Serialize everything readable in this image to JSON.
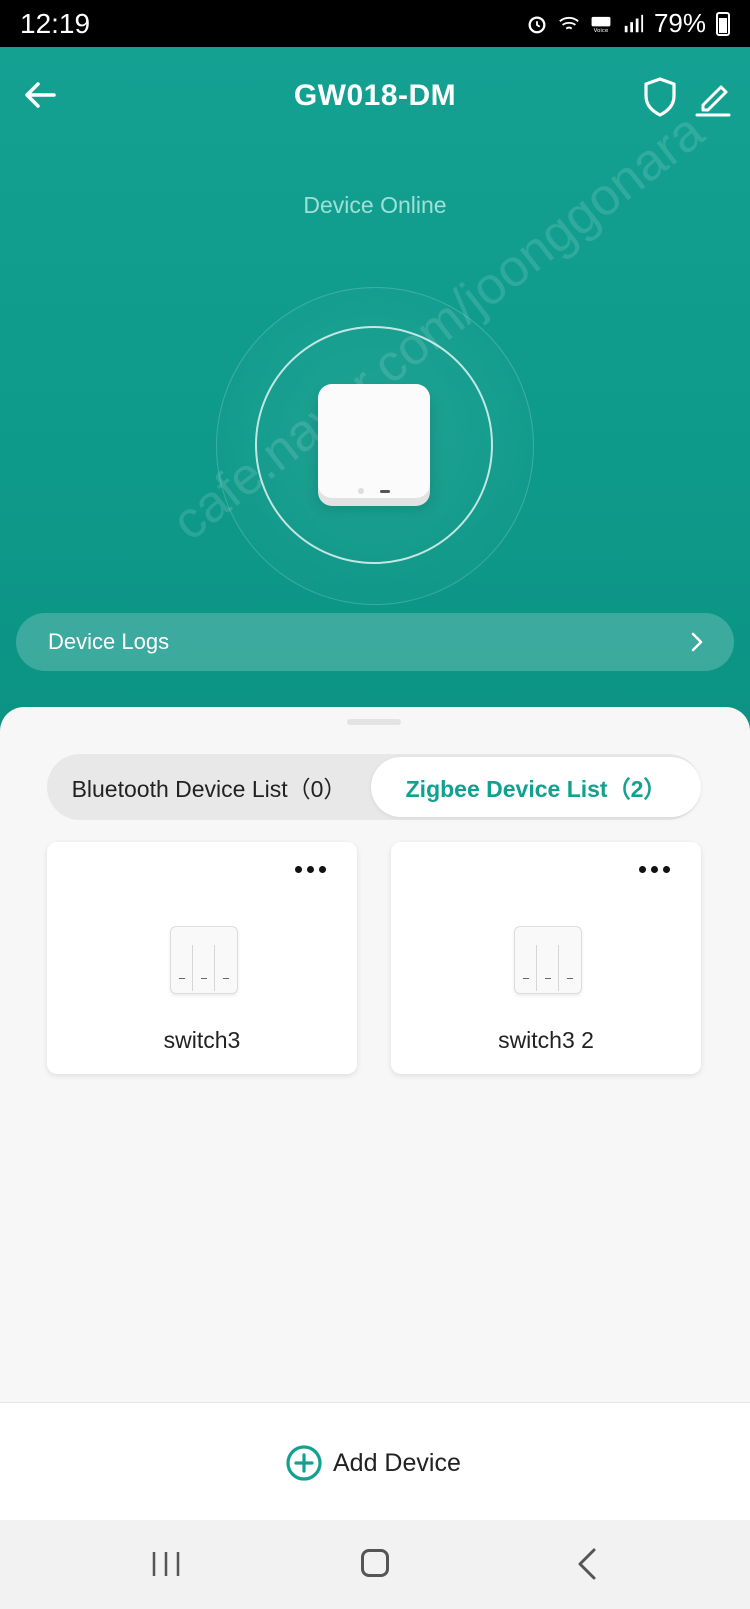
{
  "status_bar": {
    "time": "12:19",
    "battery": "79%"
  },
  "header": {
    "title": "GW018-DM"
  },
  "device": {
    "status": "Device Online"
  },
  "logs": {
    "label": "Device Logs"
  },
  "tabs": [
    {
      "label": "Bluetooth Device List（0）",
      "active": false
    },
    {
      "label": "Zigbee Device List（2）",
      "active": true
    }
  ],
  "devices": [
    {
      "name": "switch3"
    },
    {
      "name": "switch3 2"
    }
  ],
  "footer": {
    "add_label": "Add Device"
  },
  "watermark": {
    "text": "cafe.naver.com/joonggonara"
  },
  "colors": {
    "accent": "#12a090",
    "header_bg": "#0e9a8a"
  }
}
